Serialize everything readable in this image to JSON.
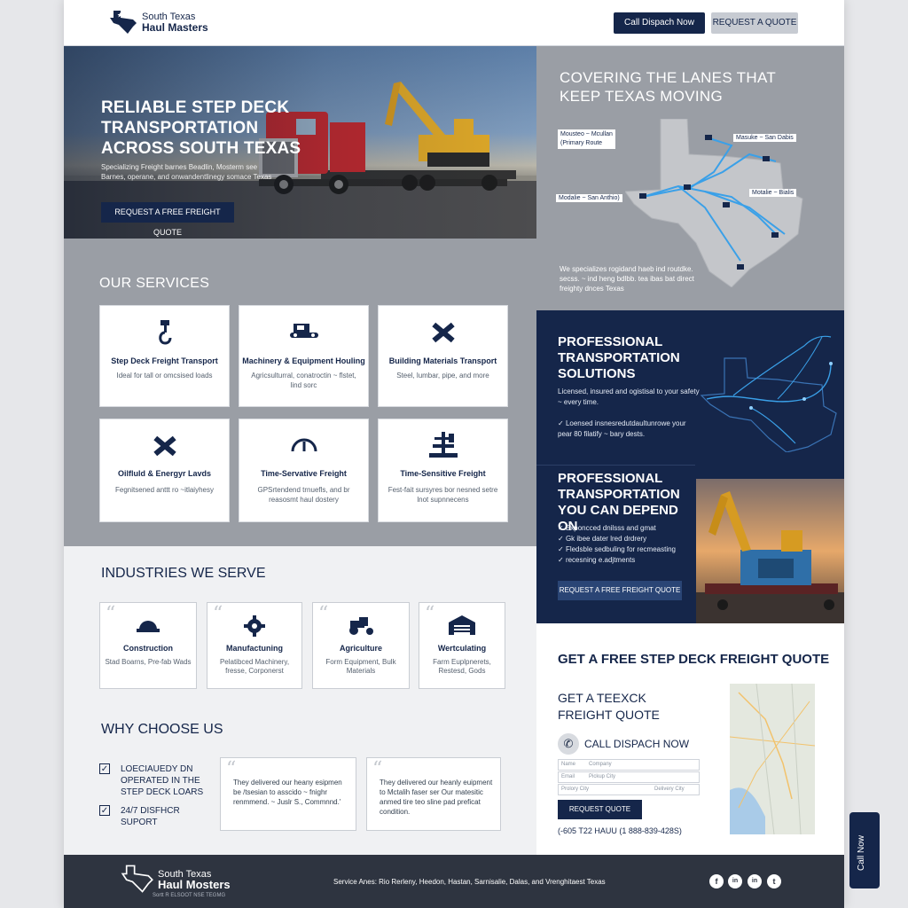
{
  "header": {
    "brand_line1": "South Texas",
    "brand_line2": "Haul Masters",
    "call_button": "Call Dispach Now",
    "quote_button": "Request a Quote"
  },
  "hero": {
    "title": "RELIABLE STEP DECK TRANSPORTATION ACROSS SOUTH TEXAS",
    "subtitle": "Specializing Freight barnes Beadlin, Mosterm see Barnes, operane, and onwandentlinegy somace Texas",
    "cta": "Request a free freight quote"
  },
  "coverage": {
    "title": "COVERING THE LANES THAT KEEP TEXAS MOVING",
    "route_a": "Mousteo ~ Mcullan",
    "route_a_sub": "(Primary Route",
    "route_b": "Masuke ~ San Dabis",
    "route_c": "Modalie ~ San Anthio)",
    "route_d": "Motalie ~ Bialis",
    "note": "We specializes rogidand haeb ind routdke. secss. ~ ind heng bdlbb. tea ibas bat direct freighty dnces Texas"
  },
  "services": {
    "title": "OUR SERVICES",
    "items": [
      {
        "title": "Step Deck Freight Transport",
        "desc": "Ideal for tall or omcsised loads"
      },
      {
        "title": "Machinery & Equipment Houling",
        "desc": "Agricsulturral, conatroctin ~ flstet, lind sorc"
      },
      {
        "title": "Building Materials Transport",
        "desc": "Steel, lumbar, pipe, and more"
      },
      {
        "title": "Oilfluld & Energyr Lavds",
        "desc": "Fegnitsened anttt ro ~itlaiyhesy"
      },
      {
        "title": "Time-Servative Freight",
        "desc": "GPSrtendend trnuefls, and br reasosmt haul dostery"
      },
      {
        "title": "Time-Sensitive Freight",
        "desc": "Fest-fait sursyres bor nesned setre lnot supnnecens"
      }
    ]
  },
  "professional1": {
    "title": "PROFESSIONAL TRANSPORTATION SOLUTIONS",
    "text": "Licensed, insured and ogistisal to your safety ~ every time.",
    "bullet": "Loensed insnesredutdaultunrowe your pear 80 filatify ~ bary dests."
  },
  "professional2": {
    "title": "PROFESSIONAL TRANSPORTATION YOU CAN DEPEND ON",
    "bullets": [
      "Exponcced dnilsss and gmat",
      "Gk ibee dater lred drdrery",
      "Fledsble sedbuling for recmeasting",
      "recesning e.adjtments"
    ],
    "cta": "Request a free freight quote"
  },
  "industries": {
    "title": "INDUSTRIES WE SERVE",
    "items": [
      {
        "title": "Construction",
        "desc": "Stad Boarns, Pre-fab Wads"
      },
      {
        "title": "Manufactuning",
        "desc": "Pelatibced Machinery, fresse, Corponerst"
      },
      {
        "title": "Agriculture",
        "desc": "Form Equipment, Bulk Materials"
      },
      {
        "title": "Wertculating",
        "desc": "Farm Euplpnerets, Restesd, Gods"
      }
    ]
  },
  "why": {
    "title": "WHY CHOOSE US",
    "checks": [
      "LOECIAUEDY DN OPERATED IN THE STEP DECK LOARS",
      "24/7 DISFHCR SUPORT"
    ],
    "testimonials": [
      "They delivered our heany esipmen be /tsesian to asscido ~ fnighr renmmend. ~ Juslr S., Commnnd.'",
      "They delivered our heanly euipment to Mctalih faser ser Our matesitic anmed tire teo sline pad preficat condition."
    ]
  },
  "quote": {
    "title": "GET A FREE STEP DECK FREIGHT QUOTE",
    "subtitle": "GET A TEEXCK FREIGHT QUOTE",
    "call": "CALL DISPACH NOW",
    "fields": [
      "Name",
      "Company",
      "Email",
      "Pickup City",
      "Prolory City",
      "Delivery City"
    ],
    "submit": "Request quote",
    "phone": "(-605 T22 HAUU (1 888-839-428S)"
  },
  "footer": {
    "brand_line1": "South Texas",
    "brand_line2": "Haul Mosters",
    "tagline": "Sortt R ELSOOT NSE TEGMG",
    "service_areas": "Service Anes: Rio Rerleny, Heedon, Hastan, Sarnisalie, Dalas, and Vrenghitaest Texas",
    "social": [
      "f",
      "in",
      "in",
      "t"
    ]
  },
  "float_button": "Call Now",
  "colors": {
    "navy": "#15264a",
    "gray": "#9a9ea5",
    "route": "#3aa0e8"
  }
}
